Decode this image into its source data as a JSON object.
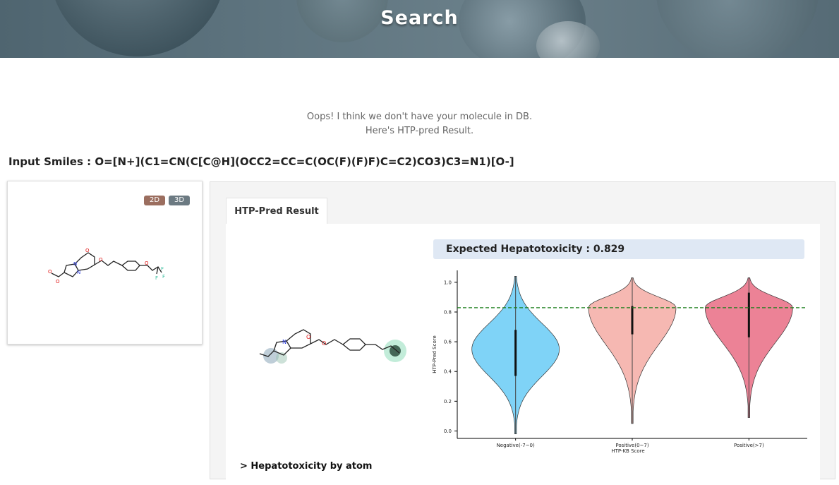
{
  "header": {
    "title": "Search"
  },
  "message": {
    "line1": "Oops! I think we don't have your molecule in DB.",
    "line2": "Here's HTP-pred Result."
  },
  "input": {
    "label": "Input Smiles : O=[N+](C1=CN(C[C@H](OCC2=CC=C(OC(F)(F)F)C=C2)CO3)C3=N1)[O-]"
  },
  "viewer": {
    "btn_2d": "2D",
    "btn_3d": "3D"
  },
  "tabs": {
    "active": "HTP-Pred Result"
  },
  "result": {
    "expected": "Expected Hepatotoxicity : 0.829",
    "by_atom": "> Hepatotoxicity by atom"
  },
  "chart_data": {
    "type": "violin",
    "categories": [
      "Negative(-7~0)",
      "Positive(0~7)",
      "Positive(>7)"
    ],
    "xlabel": "HTP-KB Score",
    "ylabel": "HTP-Pred Score",
    "yticks": [
      "0.0",
      "0.2",
      "0.4",
      "0.6",
      "0.8",
      "1.0"
    ],
    "ylim": [
      -0.05,
      1.08
    ],
    "reference_line": {
      "value": 0.829,
      "color": "#1a7f1a",
      "style": "dashed"
    },
    "series": [
      {
        "category": "Negative(-7~0)",
        "color": "#7fd3f7",
        "min": -0.02,
        "max": 1.04,
        "q1": 0.37,
        "median": 0.5,
        "q3": 0.68,
        "mode": 0.55
      },
      {
        "category": "Positive(0~7)",
        "color": "#f6b8b2",
        "min": 0.05,
        "max": 1.03,
        "q1": 0.65,
        "median": 0.75,
        "q3": 0.84,
        "mode": 0.83
      },
      {
        "category": "Positive(>7)",
        "color": "#ec8296",
        "min": 0.09,
        "max": 1.03,
        "q1": 0.63,
        "median": 0.73,
        "q3": 0.93,
        "mode": 0.83
      }
    ]
  }
}
